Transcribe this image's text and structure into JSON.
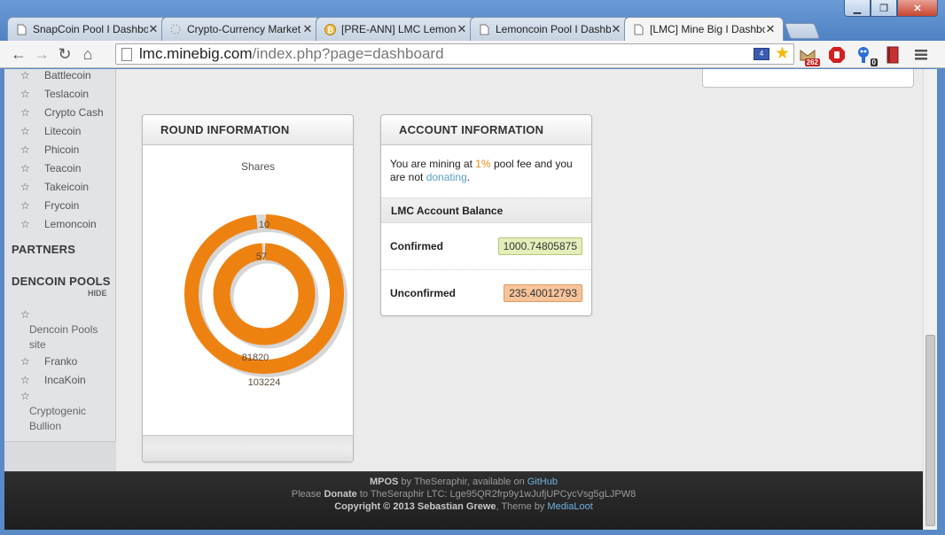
{
  "browser": {
    "tabs": [
      {
        "title": "SnapCoin Pool I Dashboard",
        "icon": "page-icon"
      },
      {
        "title": "Crypto-Currency Market",
        "icon": "loading-icon"
      },
      {
        "title": "[PRE-ANN] LMC Lemoncoin",
        "icon": "bitcoin-icon"
      },
      {
        "title": "Lemoncoin Pool I Dashboard",
        "icon": "page-icon"
      },
      {
        "title": "[LMC] Mine Big I Dashboard",
        "icon": "page-icon",
        "active": true
      }
    ],
    "url_host": "lmc.minebig.com",
    "url_path": "/index.php?page=dashboard",
    "extensions": {
      "mail_count": "262",
      "key_count": "0"
    }
  },
  "sidebar": {
    "coins": [
      "Battlecoin",
      "Teslacoin",
      "Crypto Cash",
      "Litecoin",
      "Phicoin",
      "Teacoin",
      "Takeicoin",
      "Frycoin",
      "Lemoncoin"
    ],
    "partners_heading": "PARTNERS",
    "dencoin_heading": "DENCOIN POOLS",
    "hide_label": "HIDE",
    "dencoin_site_line1": "Dencoin Pools",
    "dencoin_site_line2": "site",
    "franko": "Franko",
    "incakoin": "IncaKoin",
    "cryptogenic_line1": "Cryptogenic",
    "cryptogenic_line2": "Bullion",
    "star_glyph": "☆"
  },
  "round_info": {
    "title": "ROUND INFORMATION",
    "chart_data": {
      "type": "pie",
      "title": "Shares",
      "rings": [
        {
          "name": "outer",
          "segments": [
            {
              "value": 103224,
              "color": "#ee8211"
            },
            {
              "value": 10,
              "color": "#d8d8d8"
            }
          ]
        },
        {
          "name": "inner",
          "segments": [
            {
              "value": 81820,
              "color": "#ee8211"
            },
            {
              "value": 57,
              "color": "#d8d8d8"
            }
          ]
        }
      ],
      "labels": [
        "10",
        "57",
        "81820",
        "103224"
      ]
    }
  },
  "account_info": {
    "title": "ACCOUNT INFORMATION",
    "mining_prefix": "You are mining at ",
    "fee": "1%",
    "mining_suffix": " pool fee and you are not ",
    "donating_link": "donating",
    "period": ".",
    "balance_heading": "LMC Account Balance",
    "confirmed_label": "Confirmed",
    "confirmed_value": "1000.74805875",
    "unconfirmed_label": "Unconfirmed",
    "unconfirmed_value": "235.40012793"
  },
  "footer": {
    "mpos": "MPOS",
    "by": " by TheSeraphir, available on ",
    "github": "GitHub",
    "please": "Please ",
    "donate": "Donate",
    "donate_rest": " to TheSeraphir LTC: Lge95QR2frp9y1wJufjUPCycVsg5gLJPW8",
    "copyright": "Copyright © 2013 Sebastian Grewe",
    "theme_by": ", Theme by ",
    "medialoot": "MediaLoot"
  }
}
